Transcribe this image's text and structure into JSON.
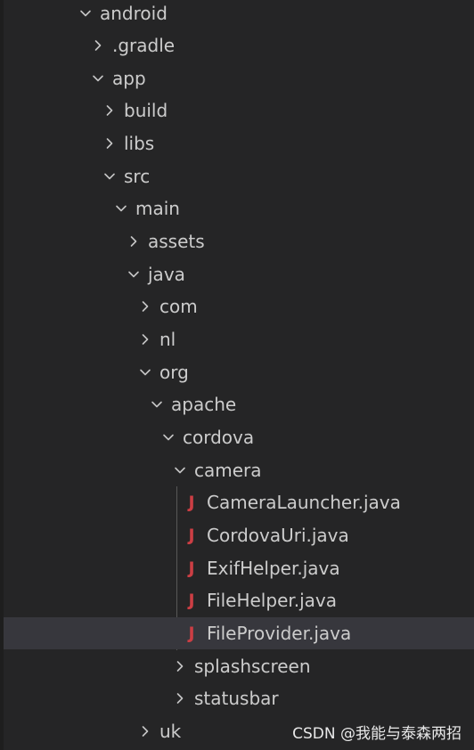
{
  "tree": {
    "items": [
      {
        "label": "android",
        "expanded": true
      },
      {
        "label": ".gradle",
        "expanded": false
      },
      {
        "label": "app",
        "expanded": true
      },
      {
        "label": "build",
        "expanded": false
      },
      {
        "label": "libs",
        "expanded": false
      },
      {
        "label": "src",
        "expanded": true
      },
      {
        "label": "main",
        "expanded": true
      },
      {
        "label": "assets",
        "expanded": false
      },
      {
        "label": "java",
        "expanded": true
      },
      {
        "label": "com",
        "expanded": false
      },
      {
        "label": "nl",
        "expanded": false
      },
      {
        "label": "org",
        "expanded": true
      },
      {
        "label": "apache",
        "expanded": true
      },
      {
        "label": "cordova",
        "expanded": true
      },
      {
        "label": "camera",
        "expanded": true
      },
      {
        "label": "CameraLauncher.java",
        "icon": "J"
      },
      {
        "label": "CordovaUri.java",
        "icon": "J"
      },
      {
        "label": "ExifHelper.java",
        "icon": "J"
      },
      {
        "label": "FileHelper.java",
        "icon": "J"
      },
      {
        "label": "FileProvider.java",
        "icon": "J",
        "selected": true
      },
      {
        "label": "splashscreen",
        "expanded": false
      },
      {
        "label": "statusbar",
        "expanded": false
      },
      {
        "label": "uk",
        "expanded": false
      }
    ]
  },
  "watermark": "CSDN @我能与泰森两招",
  "colors": {
    "background": "#252526",
    "selected_row": "#37373d",
    "java_icon": "#cc3e44",
    "text": "#cccccc"
  }
}
